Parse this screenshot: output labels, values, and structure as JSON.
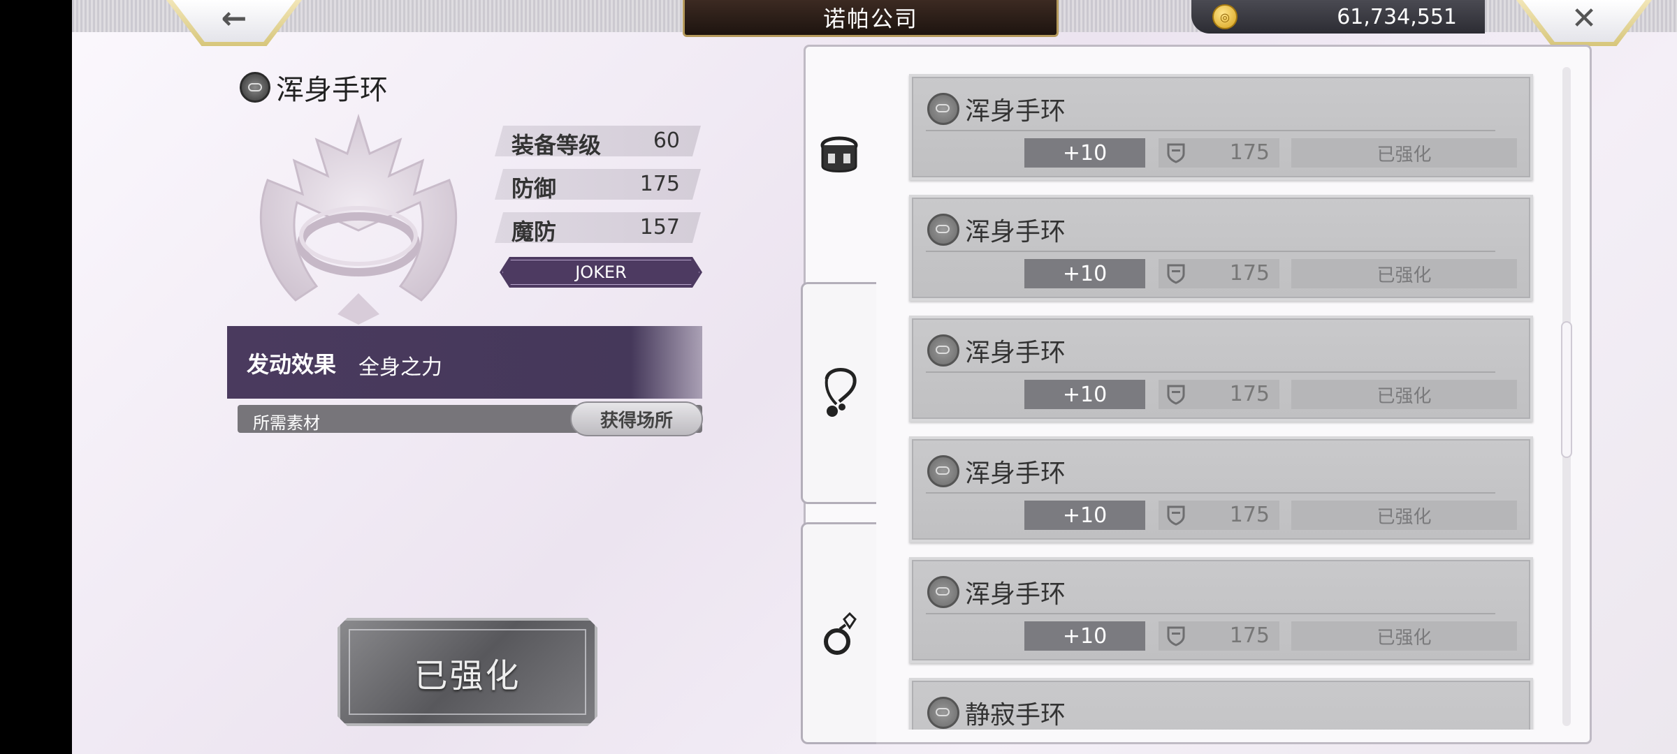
{
  "header": {
    "back_glyph": "←",
    "title": "诺帕公司",
    "currency_amount": "61,734,551",
    "close_glyph": "✕"
  },
  "item": {
    "name": "浑身手环",
    "stats": [
      {
        "label": "装备等级",
        "value": "60"
      },
      {
        "label": "防御",
        "value": "175"
      },
      {
        "label": "魔防",
        "value": "157"
      }
    ],
    "tag": "JOKER",
    "effect_label": "发动效果",
    "effect_value": "全身之力",
    "materials_label": "所需素材",
    "source_button": "获得场所",
    "enhance_button": "已强化"
  },
  "tabs": [
    {
      "icon": "bracelet-icon",
      "active": true
    },
    {
      "icon": "necklace-icon",
      "active": false
    },
    {
      "icon": "ring-icon",
      "active": false
    }
  ],
  "list": [
    {
      "name": "浑身手环",
      "level": "+10",
      "defense": "175",
      "status": "已强化"
    },
    {
      "name": "浑身手环",
      "level": "+10",
      "defense": "175",
      "status": "已强化"
    },
    {
      "name": "浑身手环",
      "level": "+10",
      "defense": "175",
      "status": "已强化"
    },
    {
      "name": "浑身手环",
      "level": "+10",
      "defense": "175",
      "status": "已强化"
    },
    {
      "name": "浑身手环",
      "level": "+10",
      "defense": "175",
      "status": "已强化"
    },
    {
      "name": "静寂手环",
      "level": "",
      "defense": "",
      "status": ""
    }
  ],
  "colors": {
    "accent_purple": "#4d3a61",
    "gold_trim": "#d7c67b",
    "card_gray": "#c5c5c7"
  }
}
